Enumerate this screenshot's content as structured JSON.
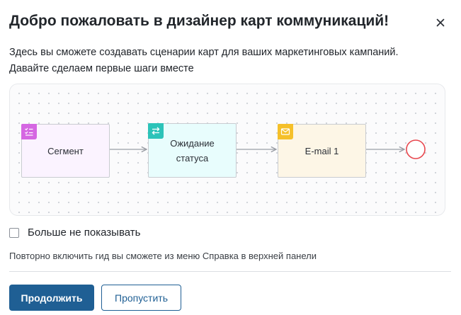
{
  "dialog": {
    "title": "Добро пожаловать в дизайнер карт коммуникаций!",
    "description_line1": "Здесь вы сможете создавать сценарии карт для ваших маркетинговых кампаний.",
    "description_line2": "Давайте сделаем первые шаги вместе"
  },
  "flow": {
    "nodes": [
      {
        "label": "Сегмент",
        "icon": "segment-list-icon",
        "color": "#d567e2"
      },
      {
        "label": "Ожидание статуса",
        "icon": "swap-arrows-icon",
        "color": "#2cc3b9"
      },
      {
        "label": "E-mail 1",
        "icon": "envelope-icon",
        "color": "#f5c02a"
      }
    ],
    "end_marker_color": "#e8474e"
  },
  "options": {
    "dont_show_label": "Больше не показывать",
    "dont_show_checked": false,
    "hint": "Повторно включить гид вы сможете из меню Справка в верхней панели"
  },
  "buttons": {
    "continue_label": "Продолжить",
    "skip_label": "Пропустить"
  },
  "colors": {
    "primary": "#1f5f94"
  }
}
